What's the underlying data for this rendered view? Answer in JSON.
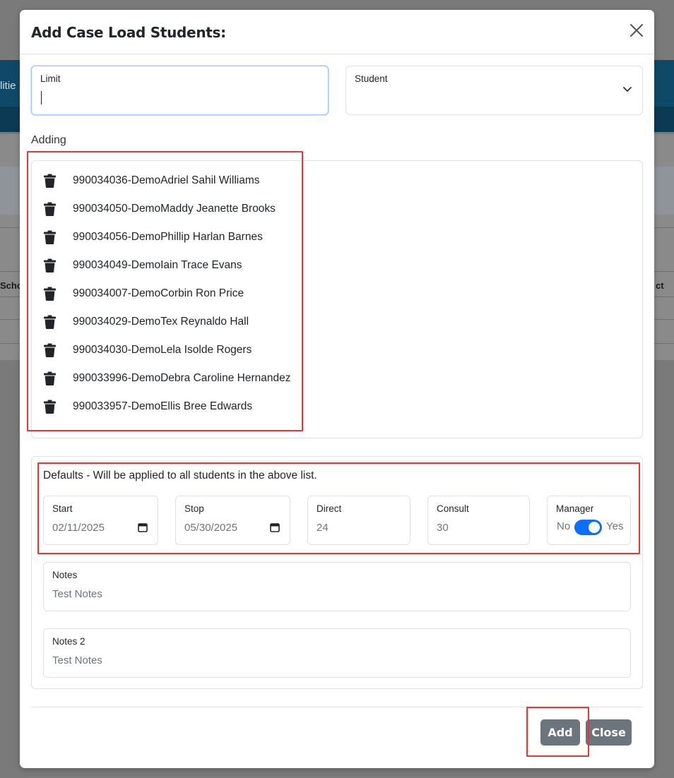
{
  "modal": {
    "title": "Add Case Load Students:"
  },
  "search": {
    "limit_label": "Limit",
    "limit_value": "",
    "student_label": "Student",
    "student_value": ""
  },
  "adding": {
    "label": "Adding",
    "students": [
      "990034036-DemoAdriel Sahil Williams",
      "990034050-DemoMaddy Jeanette Brooks",
      "990034056-DemoPhillip Harlan Barnes",
      "990034049-DemoIain Trace Evans",
      "990034007-DemoCorbin Ron Price",
      "990034029-DemoTex Reynaldo Hall",
      "990034030-DemoLela Isolde Rogers",
      "990033996-DemoDebra Caroline Hernandez",
      "990033957-DemoEllis Bree Edwards"
    ]
  },
  "defaults": {
    "description": "Defaults - Will be applied to all students in the above list.",
    "start_label": "Start",
    "start_value": "02/11/2025",
    "stop_label": "Stop",
    "stop_value": "05/30/2025",
    "direct_label": "Direct",
    "direct_value": "24",
    "consult_label": "Consult",
    "consult_value": "30",
    "manager_label": "Manager",
    "manager_no": "No",
    "manager_yes": "Yes",
    "manager_on": true,
    "notes_label": "Notes",
    "notes_value": "Test Notes",
    "notes2_label": "Notes 2",
    "notes2_value": "Test Notes"
  },
  "footer": {
    "add_label": "Add",
    "close_label": "Close"
  },
  "background": {
    "partial_text_1": "litie",
    "partial_text_2": "Scho",
    "partial_text_3": "ct"
  },
  "colors": {
    "accent": "#0d6efd",
    "button": "#6c757d",
    "highlight": "#e0383b"
  }
}
